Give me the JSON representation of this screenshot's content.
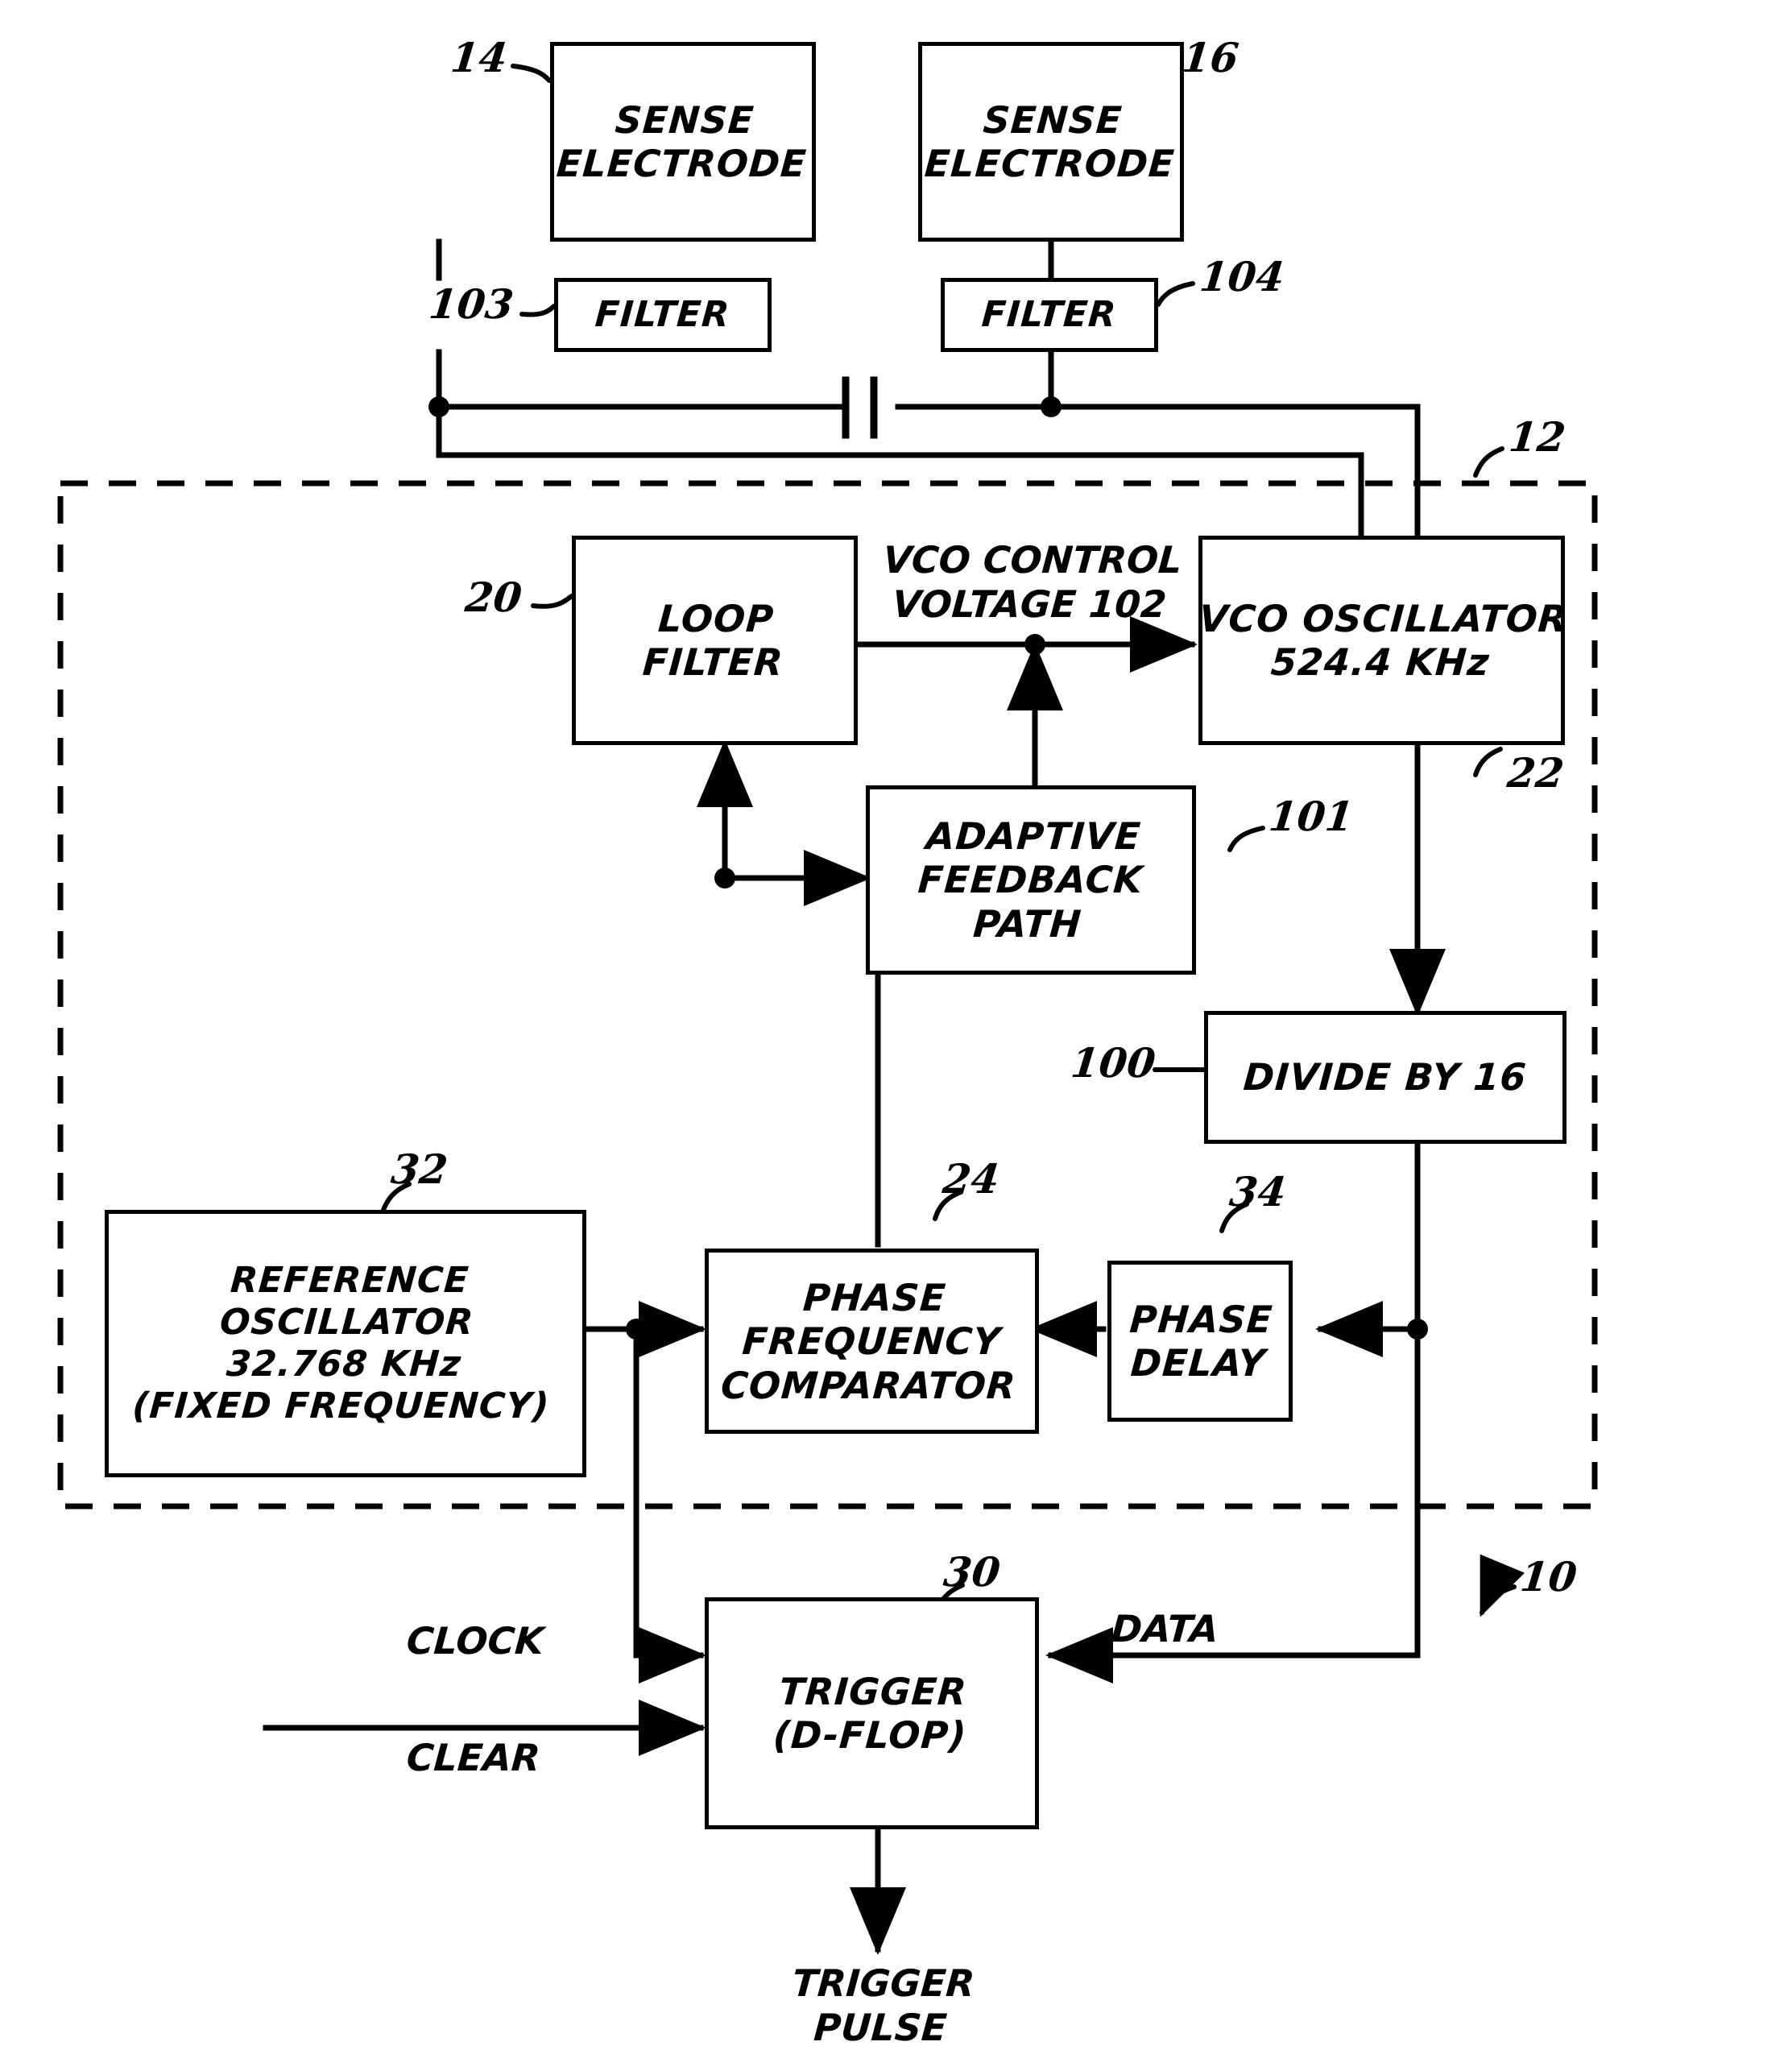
{
  "figure": {
    "type": "patent-block-diagram",
    "assembly_ref": "10",
    "dashed_enclosure_ref": "12"
  },
  "blocks": {
    "sense_electrode_left": {
      "text": "SENSE\nELECTRODE",
      "ref": "14"
    },
    "sense_electrode_right": {
      "text": "SENSE\nELECTRODE",
      "ref": "16"
    },
    "filter_left": {
      "text": "FILTER",
      "ref": "103"
    },
    "filter_right": {
      "text": "FILTER",
      "ref": "104"
    },
    "loop_filter": {
      "text": "LOOP\nFILTER",
      "ref": "20"
    },
    "vco_oscillator": {
      "text": "VCO OSCILLATOR\n524.4 KHz",
      "ref": "22"
    },
    "adaptive_feedback_path": {
      "text": "ADAPTIVE\nFEEDBACK\nPATH",
      "ref": "101"
    },
    "divide_by_16": {
      "text": "DIVIDE BY 16",
      "ref": "100"
    },
    "reference_oscillator": {
      "text": "REFERENCE\nOSCILLATOR\n32.768 KHz\n(FIXED FREQUENCY)",
      "ref": "32"
    },
    "phase_frequency_comparator": {
      "text": "PHASE\nFREQUENCY\nCOMPARATOR",
      "ref": "24"
    },
    "phase_delay": {
      "text": "PHASE\nDELAY",
      "ref": "34"
    },
    "trigger_d_flop": {
      "text": "TRIGGER\n(D-FLOP)",
      "ref": "30"
    }
  },
  "signal_labels": {
    "vco_control_voltage": "VCO CONTROL\nVOLTAGE 102",
    "clock": "CLOCK",
    "clear": "CLEAR",
    "data": "DATA",
    "trigger_pulse": "TRIGGER\nPULSE"
  },
  "reference_numerals": {
    "n14": "14",
    "n16": "16",
    "n103": "103",
    "n104": "104",
    "n12": "12",
    "n20": "20",
    "n22": "22",
    "n101": "101",
    "n100": "100",
    "n32": "32",
    "n24": "24",
    "n34": "34",
    "n30": "30",
    "n10": "10"
  },
  "colors": {
    "ink": "#000000",
    "paper": "#ffffff"
  }
}
